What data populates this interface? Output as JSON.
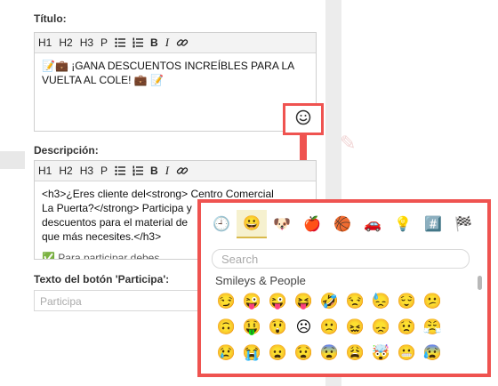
{
  "titulo": {
    "label": "Título:",
    "toolbar": [
      "H1",
      "H2",
      "H3",
      "P"
    ],
    "bold": "B",
    "italic": "I",
    "content_line1": "📝💼 ¡GANA DESCUENTOS INCREÍBLES PARA LA",
    "content_line2": "VUELTA AL COLE! 💼 📝"
  },
  "descripcion": {
    "label": "Descripción:",
    "toolbar": [
      "H1",
      "H2",
      "H3",
      "P"
    ],
    "bold": "B",
    "italic": "I",
    "line1": "<h3>¿Eres cliente del<strong> Centro Comercial",
    "line2": "La Puerta?</strong> Participa y",
    "line3": "descuentos para el material de",
    "line4": "que más necesites.</h3>",
    "line5": "✅ Para participar debes"
  },
  "participa": {
    "label": "Texto del botón 'Participa':",
    "placeholder": "Participa"
  },
  "emoji_button": {
    "icon": "smiley-icon"
  },
  "picker": {
    "categories": [
      "🕘",
      "😀",
      "🐶",
      "🍎",
      "🏀",
      "🚗",
      "💡",
      "#️⃣",
      "🏁"
    ],
    "search_placeholder": "Search",
    "section_title": "Smileys & People",
    "emojis": [
      "😏",
      "😜",
      "😜",
      "😝",
      "🤣",
      "😒",
      "😓",
      "😌",
      "😕",
      "🙃",
      "🤑",
      "😲",
      "☹",
      "🙁",
      "😖",
      "😞",
      "😟",
      "😤",
      "😢",
      "😭",
      "😦",
      "😧",
      "😨",
      "😩",
      "🤯",
      "😬",
      "😰"
    ]
  },
  "colors": {
    "highlight": "#ef5350"
  }
}
